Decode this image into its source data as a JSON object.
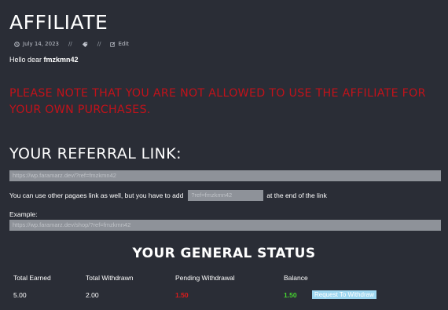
{
  "page": {
    "title": "AFFILIATE",
    "meta": {
      "date": "July 14, 2023",
      "separator": "//",
      "edit_label": "Edit"
    }
  },
  "greeting": {
    "prefix": "Hello dear",
    "username": "fmzkmn42"
  },
  "notice": "PLEASE NOTE THAT YOU ARE NOT ALLOWED TO USE THE AFFILIATE FOR YOUR OWN PURCHASES.",
  "referral": {
    "heading": "YOUR REFERRAL LINK:",
    "link_value": "https://wp.faramarz.dev/?ref=fmzkmn42",
    "instruction_before": "You can use other pagaes link as well, but you have to add",
    "param_value": "?ref=fmzkmn42",
    "instruction_after": "at the end of the link",
    "example_label": "Example:",
    "example_value": "https://wp.faramarz.dev/shop/?ref=fmzkmn42"
  },
  "status": {
    "heading": "YOUR GENERAL STATUS",
    "labels": {
      "total_earned": "Total Earned",
      "total_withdrawn": "Total Withdrawn",
      "pending_withdrawal": "Pending Withdrawal",
      "balance": "Balance"
    },
    "values": {
      "total_earned": "5.00",
      "total_withdrawn": "2.00",
      "pending_withdrawal": "1.50",
      "balance": "1.50"
    },
    "withdraw_button": "Request To Withdraw"
  },
  "colors": {
    "background": "#2a2d36",
    "notice_red": "#c2121a",
    "pending_red": "#e01b1b",
    "balance_green": "#46d430",
    "button_bg": "#9ed7f0",
    "field_bg": "#8e9299"
  },
  "icons": {
    "date": "clock-icon",
    "category": "tag-icon",
    "edit": "edit-icon"
  }
}
